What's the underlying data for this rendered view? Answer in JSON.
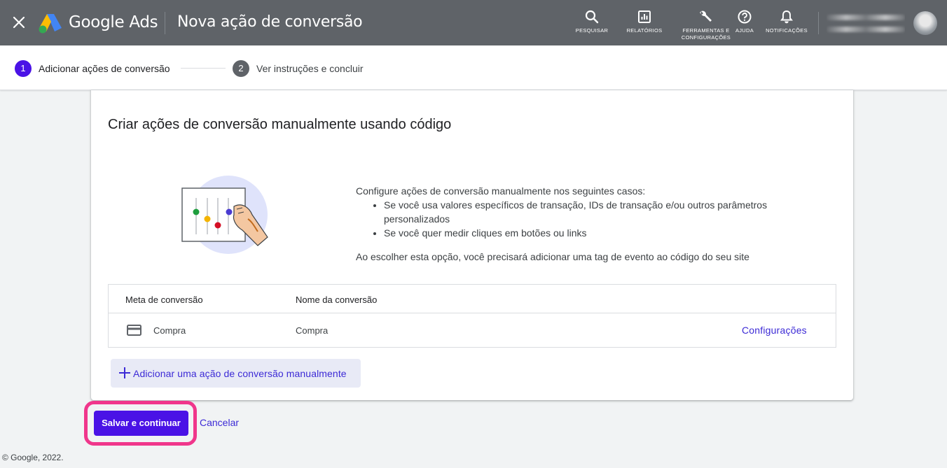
{
  "header": {
    "brand": "Google Ads",
    "title": "Nova ação de conversão",
    "tools": [
      {
        "label": "PESQUISAR",
        "icon": "search-icon"
      },
      {
        "label": "RELATÓRIOS",
        "icon": "reports-icon"
      },
      {
        "label": "FERRAMENTAS E\nCONFIGURAÇÕES",
        "icon": "wrench-icon"
      },
      {
        "label": "AJUDA",
        "icon": "help-icon"
      },
      {
        "label": "NOTIFICAÇÕES",
        "icon": "bell-icon"
      }
    ]
  },
  "stepper": {
    "steps": [
      {
        "number": "1",
        "label": "Adicionar ações de conversão",
        "active": true
      },
      {
        "number": "2",
        "label": "Ver instruções e concluir",
        "active": false
      }
    ]
  },
  "card": {
    "title": "Criar ações de conversão manualmente usando código",
    "intro": "Configure ações de conversão manualmente nos seguintes casos:",
    "bullets": [
      "Se você usa valores específicos de transação, IDs de transação e/ou outros parâmetros personalizados",
      "Se você quer medir cliques em botões ou links"
    ],
    "note": "Ao escolher esta opção, você precisará adicionar uma tag de evento ao código do seu site",
    "table": {
      "headers": [
        "Meta de conversão",
        "Nome da conversão"
      ],
      "rows": [
        {
          "goal": "Compra",
          "name": "Compra",
          "action": "Configurações",
          "icon": "credit-card-icon"
        }
      ]
    },
    "add_button": "Adicionar uma ação de conversão manualmente"
  },
  "actions": {
    "save": "Salvar e continuar",
    "cancel": "Cancelar"
  },
  "footer": {
    "copyright": "© Google, 2022."
  },
  "colors": {
    "header_bg": "#5f6368",
    "accent": "#4a12e6",
    "link": "#3c2ad6",
    "highlight": "#f0368b"
  }
}
